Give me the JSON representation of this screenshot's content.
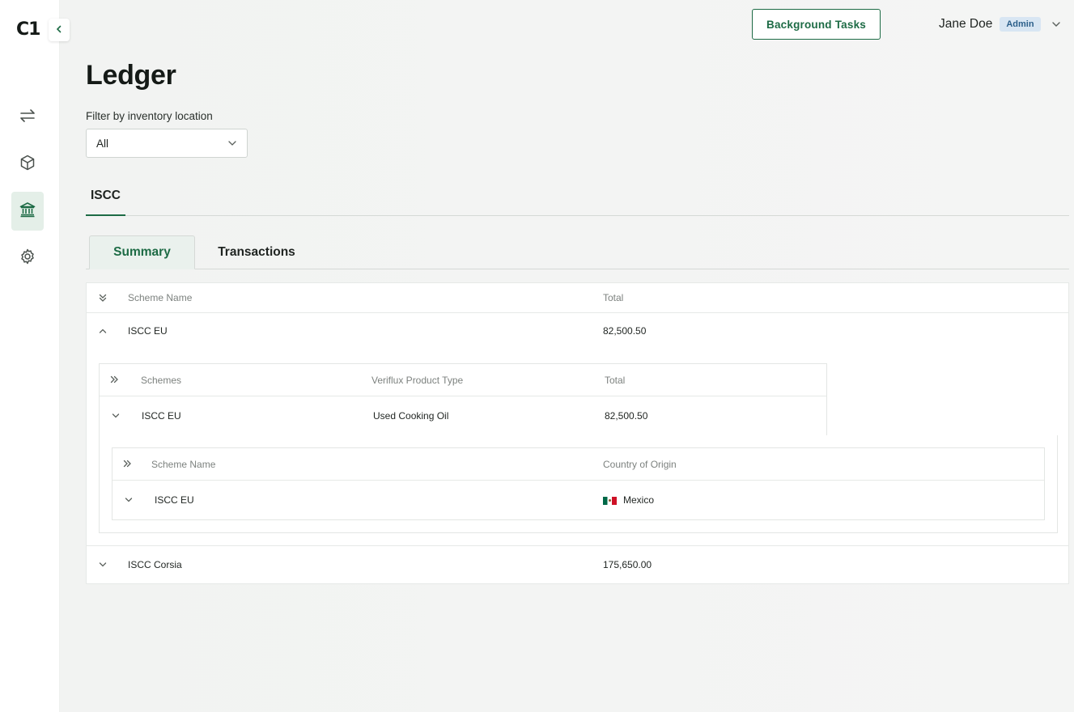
{
  "app": {
    "logo": "C1"
  },
  "sidebar": {
    "items": [
      {
        "name": "transfers",
        "icon": "arrows-exchange-icon"
      },
      {
        "name": "inventory",
        "icon": "cube-icon"
      },
      {
        "name": "ledger",
        "icon": "bank-icon",
        "active": true
      },
      {
        "name": "settings",
        "icon": "gear-icon"
      }
    ]
  },
  "header": {
    "background_tasks_label": "Background Tasks",
    "user_name": "Jane Doe",
    "user_role": "Admin"
  },
  "page": {
    "title": "Ledger",
    "filter_label": "Filter by inventory location",
    "filter_value": "All"
  },
  "scheme_tabs": [
    {
      "label": "ISCC",
      "active": true
    }
  ],
  "view_tabs": [
    {
      "label": "Summary",
      "active": true
    },
    {
      "label": "Transactions",
      "active": false
    }
  ],
  "table": {
    "columns": [
      "Scheme Name",
      "Total"
    ],
    "rows": [
      {
        "scheme_name": "ISCC EU",
        "total": "82,500.50",
        "expanded": true,
        "nested": {
          "columns": [
            "Schemes",
            "Veriflux Product Type",
            "Total"
          ],
          "rows": [
            {
              "scheme": "ISCC EU",
              "product_type": "Used Cooking Oil",
              "total": "82,500.50",
              "nested": {
                "columns": [
                  "Scheme Name",
                  "Country of Origin"
                ],
                "rows": [
                  {
                    "scheme_name": "ISCC EU",
                    "country": "Mexico"
                  }
                ]
              }
            }
          ]
        }
      },
      {
        "scheme_name": "ISCC Corsia",
        "total": "175,650.00",
        "expanded": false
      }
    ]
  },
  "colors": {
    "accent": "#1d6b45",
    "badge_bg": "#d8e6f3",
    "badge_text": "#2b5f8a"
  }
}
